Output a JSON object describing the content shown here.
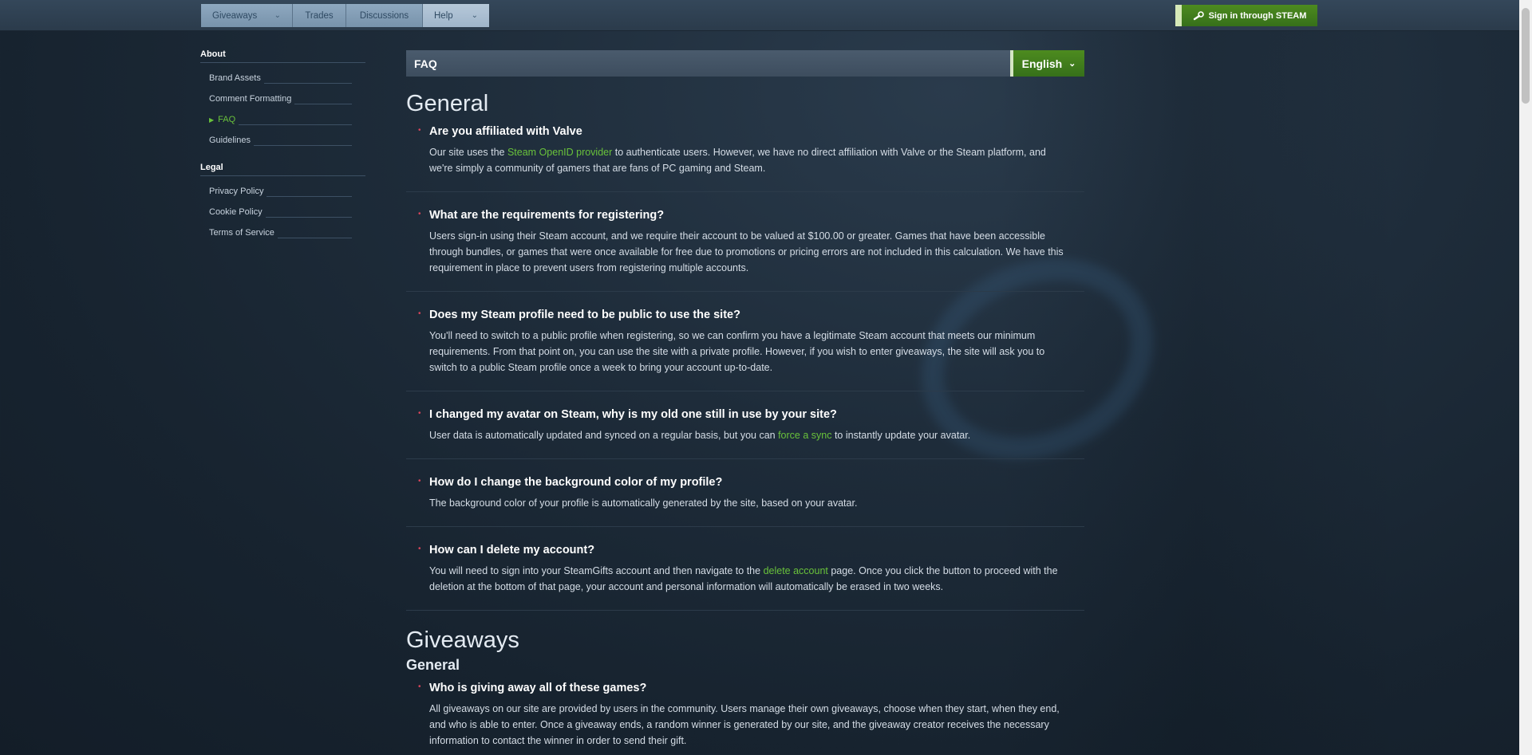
{
  "nav": {
    "giveaways": "Giveaways",
    "trades": "Trades",
    "discussions": "Discussions",
    "help": "Help",
    "signin": "Sign in through STEAM"
  },
  "sidebar": {
    "about_heading": "About",
    "about_items": [
      {
        "label": "Brand Assets",
        "active": false
      },
      {
        "label": "Comment Formatting",
        "active": false
      },
      {
        "label": "FAQ",
        "active": true
      },
      {
        "label": "Guidelines",
        "active": false
      }
    ],
    "legal_heading": "Legal",
    "legal_items": [
      {
        "label": "Privacy Policy"
      },
      {
        "label": "Cookie Policy"
      },
      {
        "label": "Terms of Service"
      }
    ]
  },
  "main": {
    "page_title": "FAQ",
    "language": "English",
    "section1_title": "General",
    "qa": [
      {
        "q": "Are you affiliated with Valve",
        "a_pre": "Our site uses the ",
        "a_link": "Steam OpenID provider",
        "a_post": " to authenticate users. However, we have no direct affiliation with Valve or the Steam platform, and we're simply a community of gamers that are fans of PC gaming and Steam."
      },
      {
        "q": "What are the requirements for registering?",
        "a": "Users sign-in using their Steam account, and we require their account to be valued at $100.00 or greater. Games that have been accessible through bundles, or games that were once available for free due to promotions or pricing errors are not included in this calculation. We have this requirement in place to prevent users from registering multiple accounts."
      },
      {
        "q": "Does my Steam profile need to be public to use the site?",
        "a": "You'll need to switch to a public profile when registering, so we can confirm you have a legitimate Steam account that meets our minimum requirements. From that point on, you can use the site with a private profile. However, if you wish to enter giveaways, the site will ask you to switch to a public Steam profile once a week to bring your account up-to-date."
      },
      {
        "q": "I changed my avatar on Steam, why is my old one still in use by your site?",
        "a_pre": "User data is automatically updated and synced on a regular basis, but you can ",
        "a_link": "force a sync",
        "a_post": " to instantly update your avatar."
      },
      {
        "q": "How do I change the background color of my profile?",
        "a": "The background color of your profile is automatically generated by the site, based on your avatar."
      },
      {
        "q": "How can I delete my account?",
        "a_pre": "You will need to sign into your SteamGifts account and then navigate to the ",
        "a_link": "delete account",
        "a_post": " page. Once you click the button to proceed with the deletion at the bottom of that page, your account and personal information will automatically be erased in two weeks."
      }
    ],
    "section2_title": "Giveaways",
    "section2_sub": "General",
    "qa2": [
      {
        "q": "Who is giving away all of these games?",
        "a": "All giveaways on our site are provided by users in the community. Users manage their own giveaways, choose when they start, when they end, and who is able to enter. Once a giveaway ends, a random winner is generated by our site, and the giveaway creator receives the necessary information to contact the winner in order to send their gift."
      }
    ]
  },
  "colors": {
    "accent_green": "#69c23b",
    "button_green": "#4d8b1f",
    "bullet_red": "#d6445a"
  }
}
